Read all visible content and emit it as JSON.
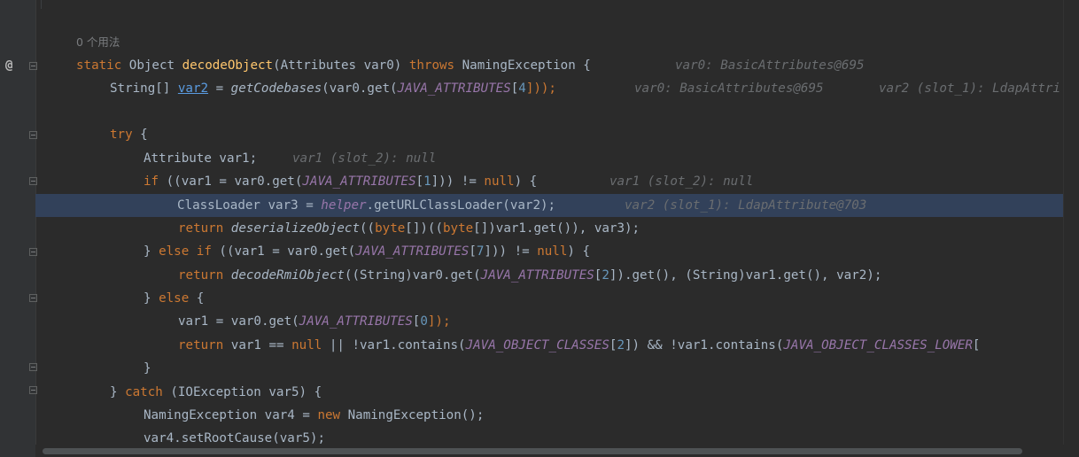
{
  "usage_hint": "0 个用法",
  "gutter": {
    "at_marker": "@"
  },
  "lines": {
    "l1": {
      "p1": "static",
      "p2": " Object ",
      "p3": "decodeObject",
      "p4": "(Attributes var0) ",
      "p5": "throws",
      "p6": " NamingException {",
      "hint": "var0: BasicAttributes@695"
    },
    "l2": {
      "p1": "String[] ",
      "p2": "var2",
      "p3": " = ",
      "p4": "getCodebases",
      "p5": "(var0.get(",
      "p6": "JAVA_ATTRIBUTES",
      "p7": "[",
      "p8": "4",
      "p9": "]));",
      "hint1": "var0: BasicAttributes@695",
      "hint2": "var2 (slot_1): LdapAttri"
    },
    "l3": {
      "p1": "try",
      "p2": " {"
    },
    "l4": {
      "p1": "Attribute var1;",
      "hint": "var1 (slot_2): null"
    },
    "l5": {
      "p1": "if",
      "p2": " ((var1 = var0.get(",
      "p3": "JAVA_ATTRIBUTES",
      "p4": "[",
      "p5": "1",
      "p6": "])) != ",
      "p7": "null",
      "p8": ") {",
      "hint": "var1 (slot_2): null"
    },
    "l6": {
      "p1": "ClassLoader var3 = ",
      "p2": "helper",
      "p3": ".getURLClassLoader(var2);",
      "hint": "var2 (slot_1): LdapAttribute@703"
    },
    "l7": {
      "p1": "return",
      "p2": " ",
      "p3": "deserializeObject",
      "p4": "((",
      "p5": "byte",
      "p6": "[])((",
      "p7": "byte",
      "p8": "[])var1.get()), var3);"
    },
    "l8": {
      "p1": "} ",
      "p2": "else if",
      "p3": " ((var1 = var0.get(",
      "p4": "JAVA_ATTRIBUTES",
      "p5": "[",
      "p6": "7",
      "p7": "])) != ",
      "p8": "null",
      "p9": ") {"
    },
    "l9": {
      "p1": "return",
      "p2": " ",
      "p3": "decodeRmiObject",
      "p4": "((String)var0.get(",
      "p5": "JAVA_ATTRIBUTES",
      "p6": "[",
      "p7": "2",
      "p8": "]).get(), (String)var1.get(), var2);"
    },
    "l10": {
      "p1": "} ",
      "p2": "else",
      "p3": " {"
    },
    "l11": {
      "p1": "var1 = var0.get(",
      "p2": "JAVA_ATTRIBUTES",
      "p3": "[",
      "p4": "0",
      "p5": "]);"
    },
    "l12": {
      "p1": "return",
      "p2": " var1 == ",
      "p3": "null",
      "p4": " || !var1.contains(",
      "p5": "JAVA_OBJECT_CLASSES",
      "p6": "[",
      "p7": "2",
      "p8": "]) && !var1.contains(",
      "p9": "JAVA_OBJECT_CLASSES_LOWER",
      "p10": "["
    },
    "l13": {
      "p1": "}"
    },
    "l14": {
      "p1": "} ",
      "p2": "catch",
      "p3": " (IOException var5) {"
    },
    "l15": {
      "p1": "NamingException var4 = ",
      "p2": "new",
      "p3": " NamingException();"
    },
    "l16": {
      "p1": "var4.setRootCause(var5);"
    }
  }
}
